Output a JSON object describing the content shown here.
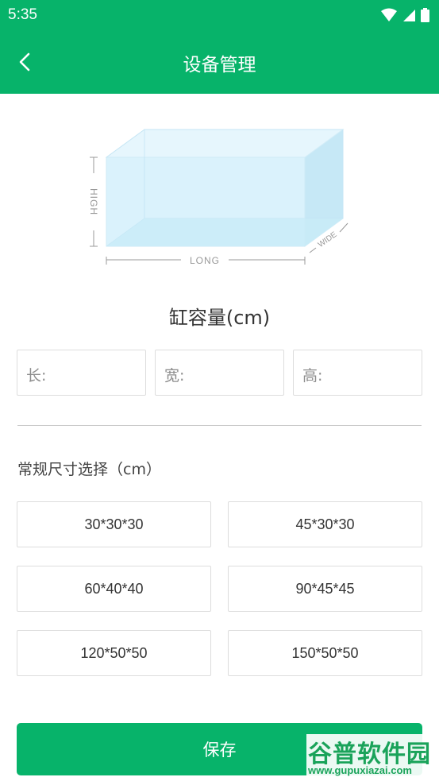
{
  "status_bar": {
    "time": "5:35",
    "icons": [
      "wifi-icon",
      "cell-signal-icon",
      "battery-icon"
    ]
  },
  "app_bar": {
    "title": "设备管理",
    "back_icon": "chevron-left-icon"
  },
  "diagram": {
    "high_label": "HIGH",
    "long_label": "LONG",
    "wide_label": "WIDE"
  },
  "capacity_title": "缸容量(cm)",
  "dimensions": {
    "length_label": "长:",
    "width_label": "宽:",
    "height_label": "高:"
  },
  "presets": {
    "label": "常规尺寸选择（cm）",
    "options": [
      "30*30*30",
      "45*30*30",
      "60*40*40",
      "90*45*45",
      "120*50*50",
      "150*50*50"
    ]
  },
  "save_label": "保存",
  "watermark": {
    "title": "谷普软件园",
    "url": "www.gupuxiazai.com"
  },
  "colors": {
    "brand": "#07b36a",
    "border": "#dddddd",
    "tank_fill": "#d6f0fb"
  }
}
